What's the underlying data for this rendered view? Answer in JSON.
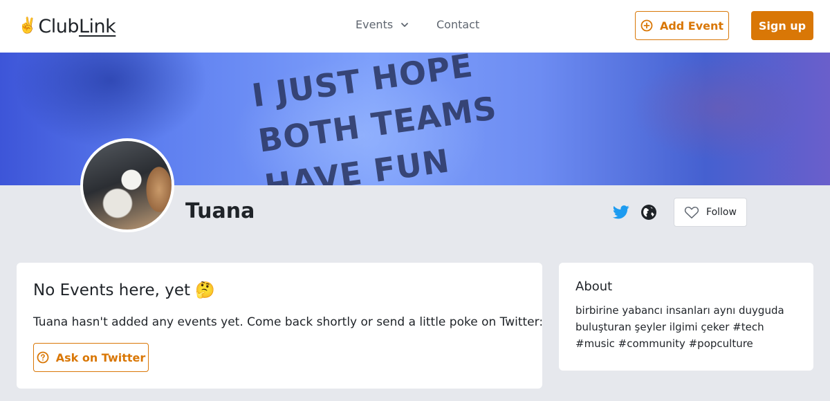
{
  "header": {
    "logo_emoji": "✌️",
    "logo_club": "Club",
    "logo_link": "Link",
    "nav": {
      "events_label": "Events",
      "contact_label": "Contact"
    },
    "add_event_label": "Add Event",
    "sign_up_label": "Sign up"
  },
  "cover": {
    "text": "I JUST HOPE\nBOTH TEAMS\nHAVE FUN"
  },
  "profile": {
    "name": "Tuana",
    "follow_label": "Follow",
    "icons": [
      "twitter-icon",
      "globe-icon",
      "heart-icon"
    ]
  },
  "events_card": {
    "title": "No Events here, yet 🤔",
    "text": "Tuana hasn't added any events yet. Come back shortly or send a little poke on Twitter:",
    "button_label": "Ask on Twitter"
  },
  "about_card": {
    "title": "About",
    "text": "birbirine yabancı insanları aynı duyguda buluşturan şeyler ilgimi çeker #tech #music #community #popculture"
  },
  "colors": {
    "accent": "#d97706",
    "twitter": "#1d9bf0",
    "background": "#e6e8ed"
  }
}
